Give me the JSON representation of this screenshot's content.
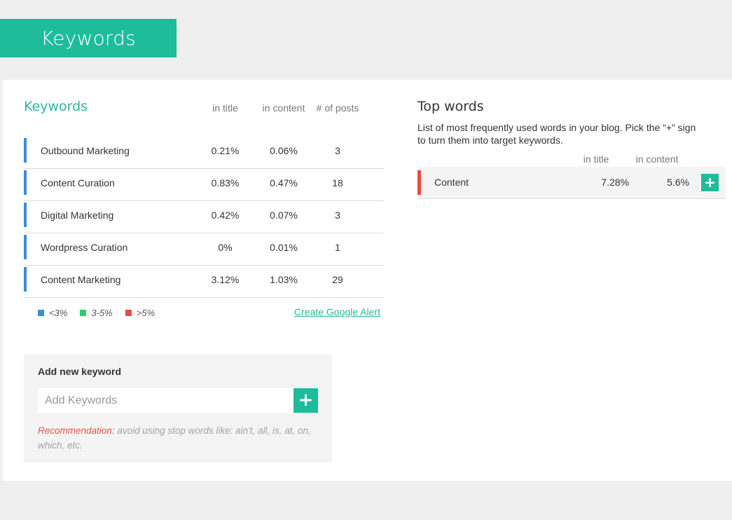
{
  "header": {
    "title": "Keywords"
  },
  "keywords": {
    "title": "Keywords",
    "columns": {
      "in_title": "in title",
      "in_content": "in content",
      "posts": "# of posts"
    },
    "rows": [
      {
        "name": "Outbound Marketing",
        "in_title": "0.21%",
        "in_content": "0.06%",
        "posts": "3"
      },
      {
        "name": "Content Curation",
        "in_title": "0.83%",
        "in_content": "0.47%",
        "posts": "18"
      },
      {
        "name": "Digital Marketing",
        "in_title": "0.42%",
        "in_content": "0.07%",
        "posts": "3"
      },
      {
        "name": "Wordpress Curation",
        "in_title": "0%",
        "in_content": "0.01%",
        "posts": "1"
      },
      {
        "name": "Content Marketing",
        "in_title": "3.12%",
        "in_content": "1.03%",
        "posts": "29"
      }
    ],
    "row_bar_color": "#3a8fd3",
    "legend": [
      {
        "label": "<3%",
        "color": "#3a8fd3"
      },
      {
        "label": "3-5%",
        "color": "#2ecc71"
      },
      {
        "label": ">5%",
        "color": "#e74c3c"
      }
    ],
    "alert_link": "Create Google Alert"
  },
  "add_keyword": {
    "title": "Add new keyword",
    "placeholder": "Add Keywords",
    "button": "+",
    "recommendation_label": "Recommendation:",
    "recommendation_text": " avoid using stop words like: ain't, all, is, at, on, which, etc."
  },
  "top_words": {
    "title": "Top words",
    "description": "List of most frequently used words in your blog. Pick the “+” sign to turn them into target keywords.",
    "columns": {
      "in_title": "in title",
      "in_content": "in content"
    },
    "rows": [
      {
        "name": "Content",
        "in_title": "7.28%",
        "in_content": "5.6%",
        "button": "+",
        "bar_color": "#e74c3c"
      }
    ]
  },
  "colors": {
    "accent": "#1fbc9c",
    "heading_accent": "#2db59b",
    "warning": "#e05544"
  }
}
